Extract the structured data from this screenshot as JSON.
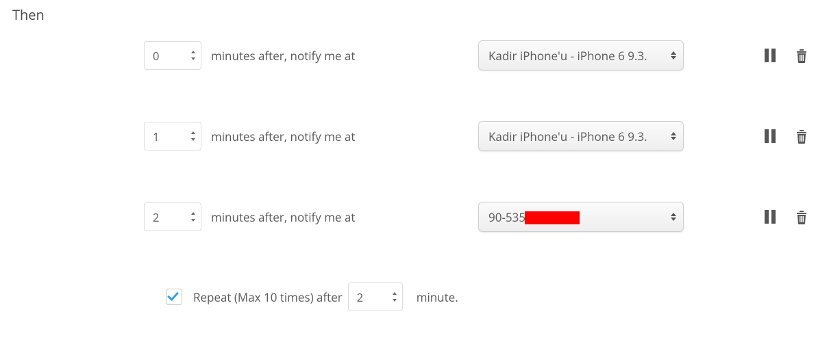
{
  "heading": "Then",
  "rows": [
    {
      "minutes": "0",
      "after_label": "minutes after, notify me at",
      "device": "Kadir iPhone'u - iPhone 6 9.3.",
      "redacted": false
    },
    {
      "minutes": "1",
      "after_label": "minutes after, notify me at",
      "device": "Kadir iPhone'u - iPhone 6 9.3.",
      "redacted": false
    },
    {
      "minutes": "2",
      "after_label": "minutes after, notify me at",
      "device": "90-535",
      "redacted": true
    }
  ],
  "repeat": {
    "checked": true,
    "label": "Repeat (Max 10 times) after",
    "value": "2",
    "unit": "minute."
  },
  "icons": {
    "pause": "pause-icon",
    "trash": "trash-icon"
  }
}
